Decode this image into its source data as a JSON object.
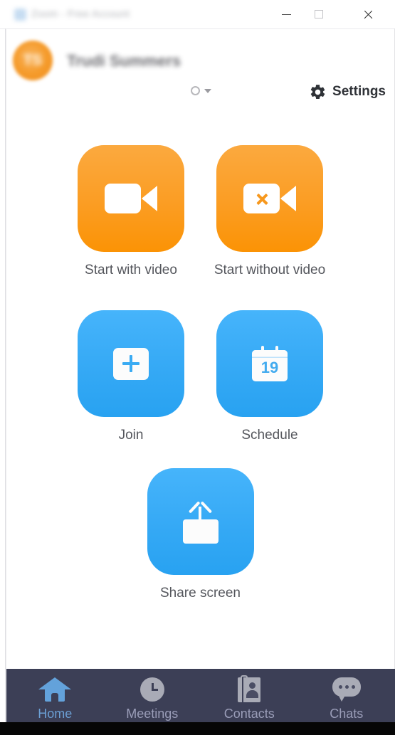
{
  "window": {
    "title": "Zoom - Free Account",
    "logo_icon": "zoom-logo-icon",
    "controls": {
      "minimize": "minimize-icon",
      "maximize": "maximize-icon",
      "close": "close-icon"
    }
  },
  "header": {
    "avatar_initials": "TS",
    "avatar_color": "#f59b2b",
    "user_name": "Trudi Summers",
    "status_icon": "status-ring-icon",
    "status_caret_icon": "chevron-down-icon",
    "settings": {
      "label": "Settings",
      "icon": "gear-icon"
    }
  },
  "main": {
    "tiles": [
      {
        "id": "start-with-video",
        "label": "Start with video",
        "icon": "video-camera-icon",
        "color": "#fb9d23",
        "style": "orange"
      },
      {
        "id": "start-without-video",
        "label": "Start without video",
        "icon": "video-camera-off-icon",
        "color": "#fb9d23",
        "style": "orange"
      },
      {
        "id": "join",
        "label": "Join",
        "icon": "plus-square-icon",
        "color": "#35a9f5",
        "style": "blue"
      },
      {
        "id": "schedule",
        "label": "Schedule",
        "icon": "calendar-icon",
        "calendar_day": "19",
        "color": "#35a9f5",
        "style": "blue"
      },
      {
        "id": "share-screen",
        "label": "Share screen",
        "icon": "share-screen-up-arrow-icon",
        "color": "#35a9f5",
        "style": "blue"
      }
    ]
  },
  "bottom_nav": {
    "background_color": "#3c3f56",
    "active_color": "#6b9fd4",
    "inactive_color": "#9a9db8",
    "items": [
      {
        "label": "Home",
        "icon": "home-icon",
        "active": true
      },
      {
        "label": "Meetings",
        "icon": "clock-icon",
        "active": false
      },
      {
        "label": "Contacts",
        "icon": "contacts-book-icon",
        "active": false
      },
      {
        "label": "Chats",
        "icon": "chat-bubble-icon",
        "active": false
      }
    ]
  }
}
